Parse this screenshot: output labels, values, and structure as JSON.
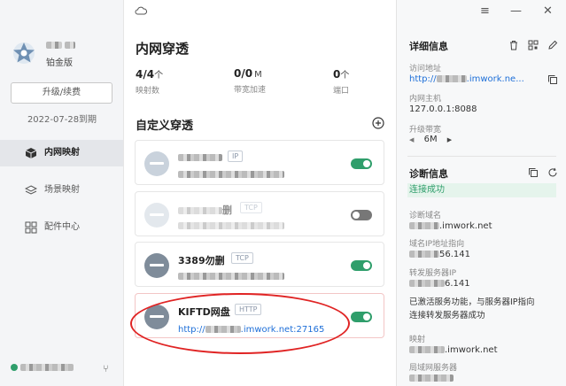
{
  "sidebar": {
    "tier": "铂金版",
    "upgrade_label": "升级/续费",
    "expire_date": "2022-07-28到期",
    "nav": [
      {
        "label": "内网映射",
        "icon": "cube-icon",
        "active": true
      },
      {
        "label": "场景映射",
        "icon": "layers-icon",
        "active": false
      },
      {
        "label": "配件中心",
        "icon": "apps-icon",
        "active": false
      }
    ]
  },
  "main": {
    "title": "内网穿透",
    "stats": [
      {
        "value": "4/4",
        "unit": "个",
        "label": "映射数"
      },
      {
        "value": "0/0",
        "unit": "M",
        "label": "带宽加速"
      },
      {
        "value": "0",
        "unit": "个",
        "label": "端口"
      }
    ],
    "section_title": "自定义穿透",
    "cards": [
      {
        "name": "",
        "tag": "IP",
        "sub": "",
        "enabled": true,
        "disabled_style": false
      },
      {
        "name": "删",
        "tag": "TCP",
        "sub": "",
        "enabled": false,
        "disabled_style": true
      },
      {
        "name": "3389勿删",
        "tag": "TCP",
        "sub": "",
        "enabled": true,
        "disabled_style": false
      },
      {
        "name": "KIFTD网盘",
        "tag": "HTTP",
        "link_prefix": "http://",
        "link_suffix": ".imwork.net:27165",
        "enabled": true,
        "disabled_style": false
      }
    ]
  },
  "details": {
    "title": "详细信息",
    "access_label": "访问地址",
    "access_prefix": "http://",
    "access_suffix": ".imwork.ne...",
    "host_label": "内网主机",
    "host_value": "127.0.0.1:8088",
    "bandwidth_label": "升级带宽",
    "bandwidth_value": "6M"
  },
  "diagnosis": {
    "title": "诊断信息",
    "status": "连接成功",
    "domain_label": "诊断域名",
    "domain_suffix": ".imwork.net",
    "ip_label": "域名IP地址指向",
    "ip_suffix": "56.141",
    "forward_label": "转发服务器IP",
    "forward_suffix": "6.141",
    "message_line1": "已激活服务功能，与服务器IP指向",
    "message_line2": "连接转发服务器成功",
    "map_label": "映射",
    "map_suffix": ".imwork.net",
    "lan_label": "局域网服务器"
  },
  "colors": {
    "accent": "#2f9e6b",
    "link": "#1e6fd8",
    "highlight": "#e02424"
  }
}
